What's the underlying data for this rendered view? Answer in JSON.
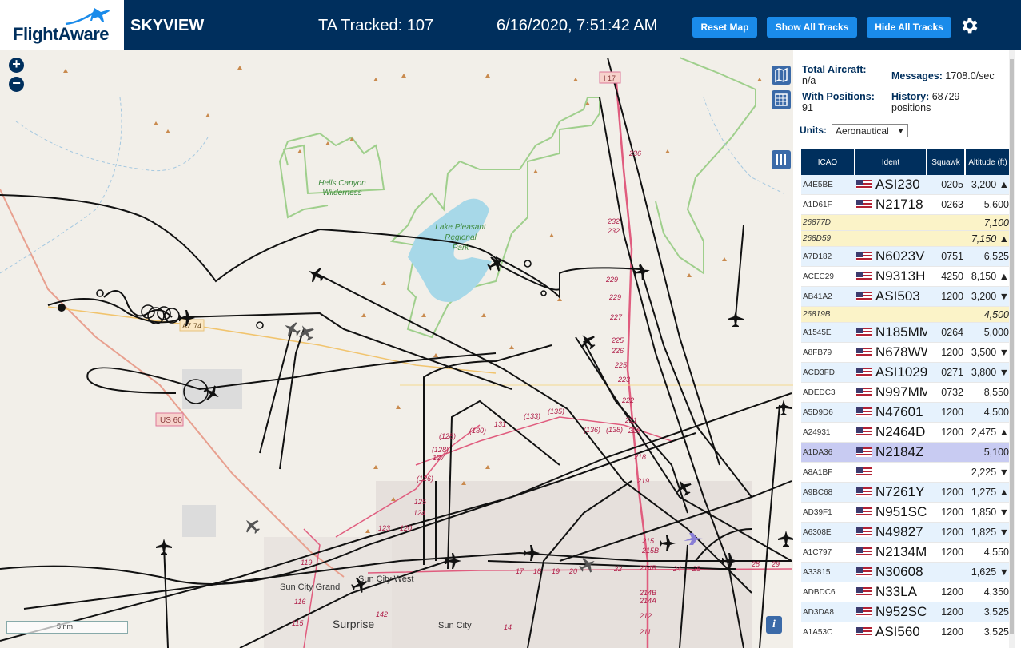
{
  "header": {
    "logo": "FlightAware",
    "title": "SKYVIEW",
    "tracked": "TA Tracked: 107",
    "datetime": "6/16/2020, 7:51:42 AM",
    "buttons": [
      "Reset Map",
      "Show All Tracks",
      "Hide All Tracks"
    ],
    "settings_icon": "gear-icon"
  },
  "map": {
    "zoom_in": "+",
    "zoom_out": "−",
    "scale_label": "5 nm",
    "info_label": "i",
    "labels": {
      "hells_canyon": "Hells Canyon",
      "wilderness": "Wilderness",
      "lake_pleasant": "Lake Pleasant",
      "regional": "Regional",
      "park": "Park",
      "az74": "AZ 74",
      "us60": "US 60",
      "i17": "I 17",
      "sun_city_grand": "Sun City Grand",
      "sun_city_west": "Sun City West",
      "surprise": "Surprise",
      "sun_city": "Sun City"
    }
  },
  "stats": {
    "total_aircraft_label": "Total Aircraft:",
    "total_aircraft_value": "n/a",
    "with_positions_label": "With Positions:",
    "with_positions_value": "91",
    "messages_label": "Messages:",
    "messages_value": "1708.0/sec",
    "history_label": "History:",
    "history_value": "68729",
    "history_unit": "positions",
    "units_label": "Units:",
    "units_value": "Aeronautical"
  },
  "table": {
    "headers": [
      "ICAO",
      "Ident",
      "Squawk",
      "Altitude (ft)"
    ],
    "rows": [
      {
        "icao": "A4E5BE",
        "ident": "ASI230",
        "squawk": "0205",
        "alt": "3,200 ▲",
        "flag": true,
        "style": "odd"
      },
      {
        "icao": "A1D61F",
        "ident": "N21718",
        "squawk": "0263",
        "alt": "5,600",
        "flag": true,
        "style": "even"
      },
      {
        "icao": "26877D",
        "ident": "",
        "squawk": "",
        "alt": "7,100",
        "flag": false,
        "style": "yel"
      },
      {
        "icao": "268D59",
        "ident": "",
        "squawk": "",
        "alt": "7,150 ▲",
        "flag": false,
        "style": "yel"
      },
      {
        "icao": "A7D182",
        "ident": "N6023V",
        "squawk": "0751",
        "alt": "6,525",
        "flag": true,
        "style": "odd"
      },
      {
        "icao": "ACEC29",
        "ident": "N9313H",
        "squawk": "4250",
        "alt": "8,150 ▲",
        "flag": true,
        "style": "even"
      },
      {
        "icao": "AB41A2",
        "ident": "ASI503",
        "squawk": "1200",
        "alt": "3,200 ▼",
        "flag": true,
        "style": "odd"
      },
      {
        "icao": "26819B",
        "ident": "",
        "squawk": "",
        "alt": "4,500",
        "flag": false,
        "style": "yel"
      },
      {
        "icao": "A1545E",
        "ident": "N185MM",
        "squawk": "0264",
        "alt": "5,000",
        "flag": true,
        "style": "odd"
      },
      {
        "icao": "A8FB79",
        "ident": "N678WW",
        "squawk": "1200",
        "alt": "3,500 ▼",
        "flag": true,
        "style": "even"
      },
      {
        "icao": "ACD3FD",
        "ident": "ASI1029",
        "squawk": "0271",
        "alt": "3,800 ▼",
        "flag": true,
        "style": "odd"
      },
      {
        "icao": "ADEDC3",
        "ident": "N997MM",
        "squawk": "0732",
        "alt": "8,550",
        "flag": true,
        "style": "even"
      },
      {
        "icao": "A5D9D6",
        "ident": "N47601",
        "squawk": "1200",
        "alt": "4,500",
        "flag": true,
        "style": "odd"
      },
      {
        "icao": "A24931",
        "ident": "N2464D",
        "squawk": "1200",
        "alt": "2,475 ▲",
        "flag": true,
        "style": "even"
      },
      {
        "icao": "A1DA36",
        "ident": "N2184Z",
        "squawk": "",
        "alt": "5,100",
        "flag": true,
        "style": "sel"
      },
      {
        "icao": "A8A1BF",
        "ident": "",
        "squawk": "",
        "alt": "2,225 ▼",
        "flag": true,
        "style": "even"
      },
      {
        "icao": "A9BC68",
        "ident": "N7261Y",
        "squawk": "1200",
        "alt": "1,275 ▲",
        "flag": true,
        "style": "odd"
      },
      {
        "icao": "AD39F1",
        "ident": "N951SC",
        "squawk": "1200",
        "alt": "1,850 ▼",
        "flag": true,
        "style": "even"
      },
      {
        "icao": "A6308E",
        "ident": "N49827",
        "squawk": "1200",
        "alt": "1,825 ▼",
        "flag": true,
        "style": "odd"
      },
      {
        "icao": "A1C797",
        "ident": "N2134M",
        "squawk": "1200",
        "alt": "4,550",
        "flag": true,
        "style": "even"
      },
      {
        "icao": "A33815",
        "ident": "N30608",
        "squawk": "",
        "alt": "1,625 ▼",
        "flag": true,
        "style": "odd"
      },
      {
        "icao": "ADBDC6",
        "ident": "N33LA",
        "squawk": "1200",
        "alt": "4,350",
        "flag": true,
        "style": "even"
      },
      {
        "icao": "AD3DA8",
        "ident": "N952SC",
        "squawk": "1200",
        "alt": "3,525",
        "flag": true,
        "style": "odd"
      },
      {
        "icao": "A1A53C",
        "ident": "ASI560",
        "squawk": "1200",
        "alt": "3,525",
        "flag": true,
        "style": "even"
      }
    ]
  }
}
